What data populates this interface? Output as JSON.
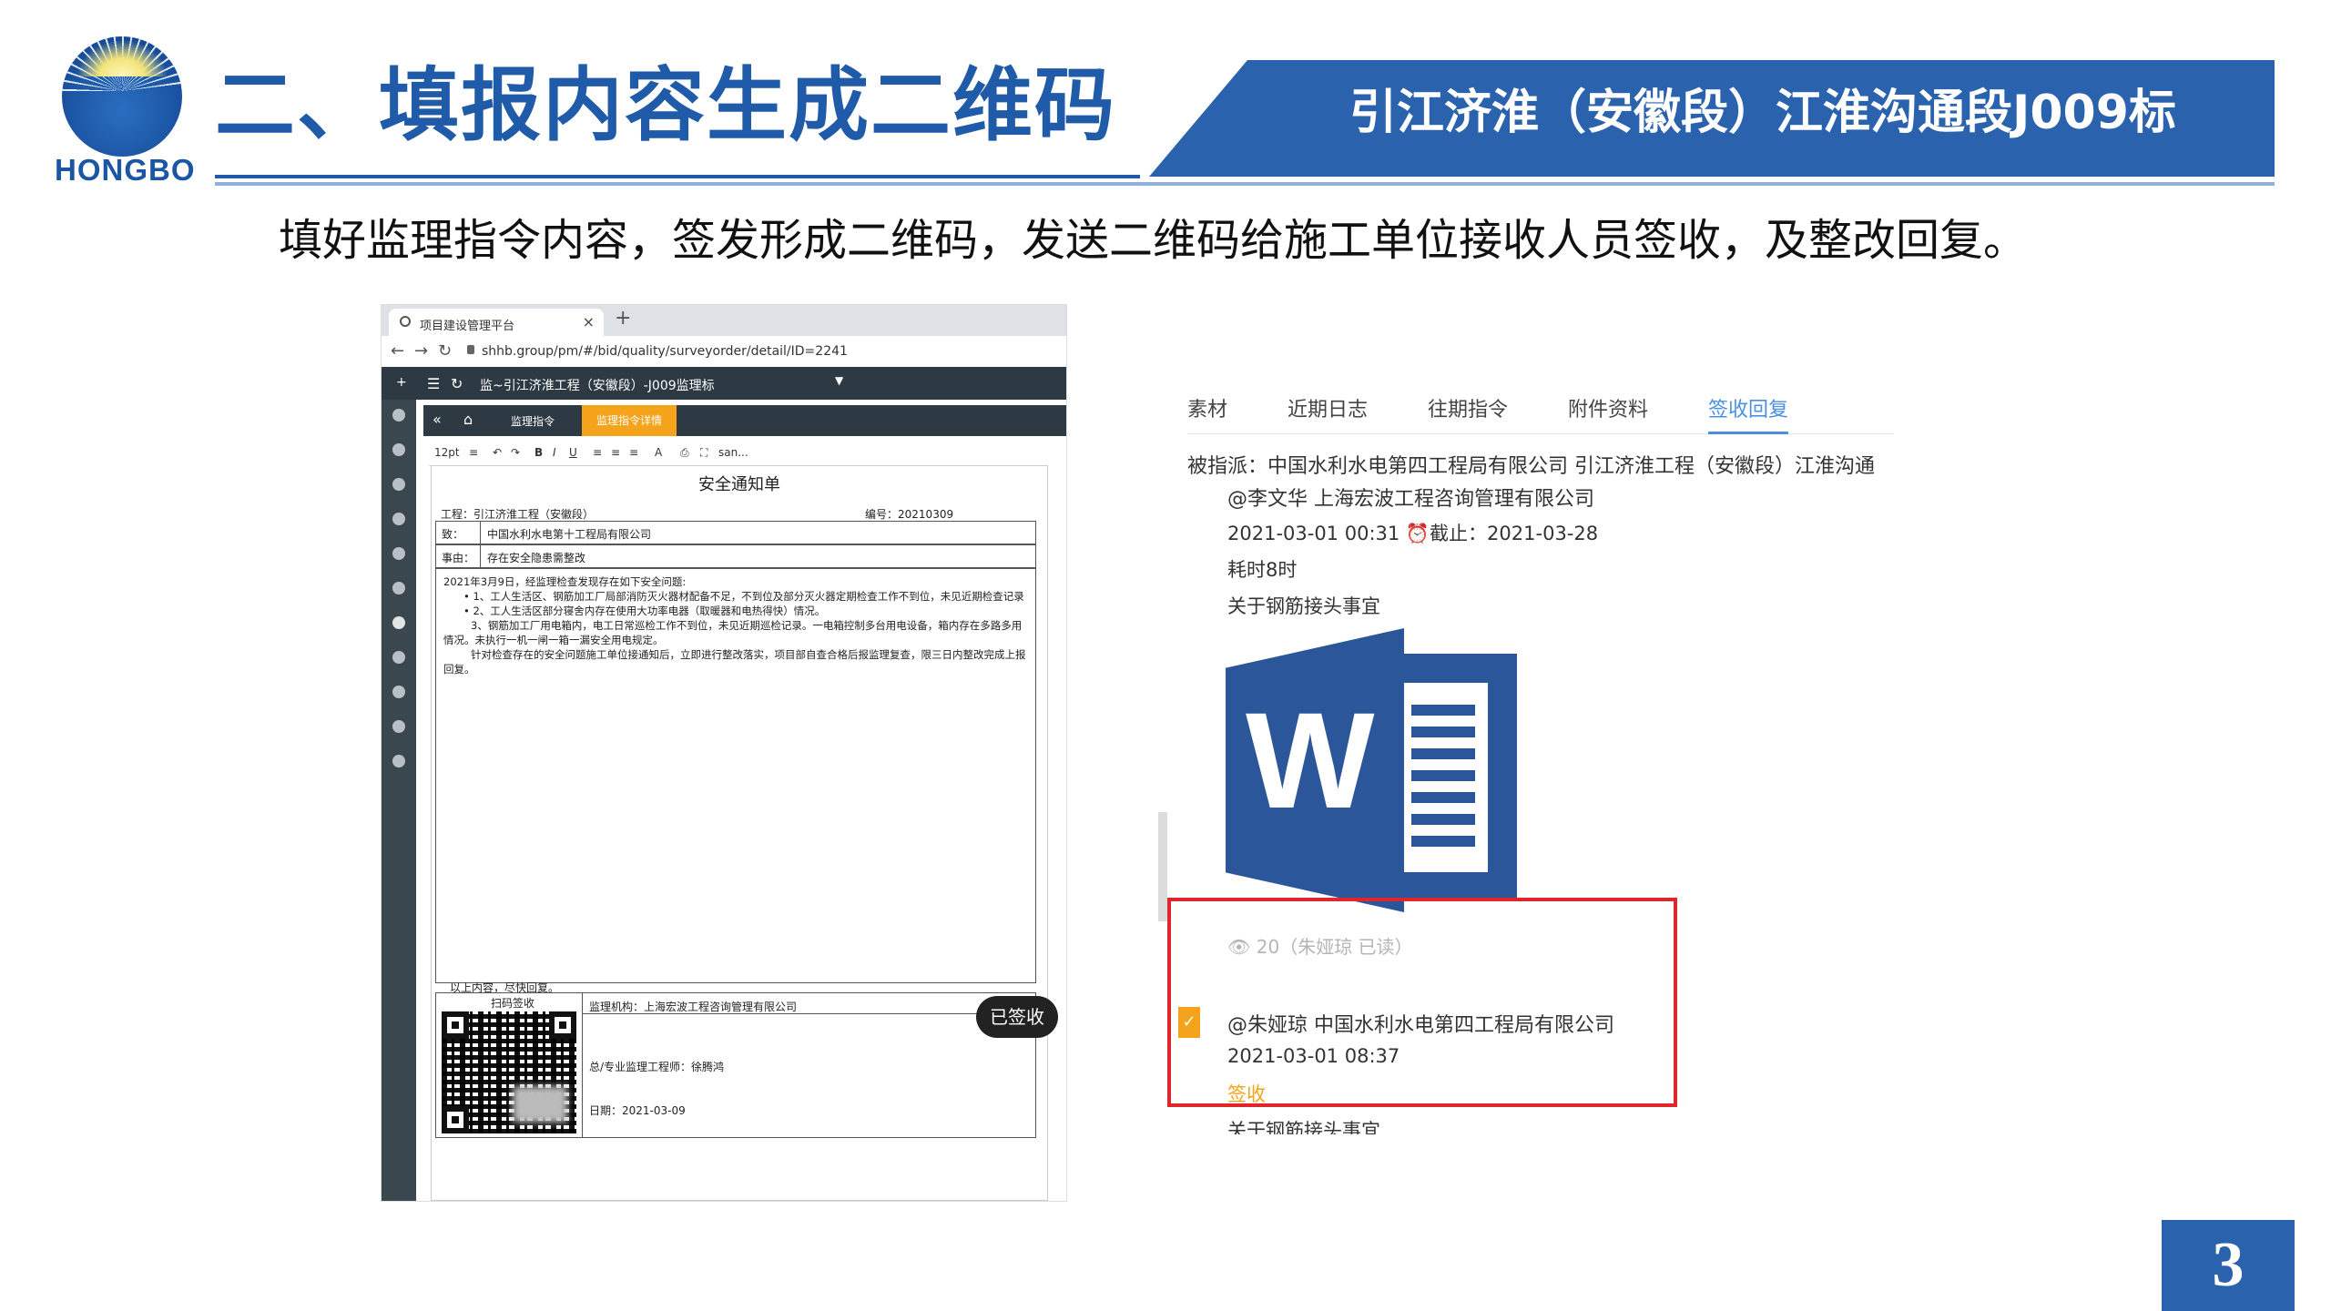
{
  "header": {
    "logo_text": "HONGBO",
    "title": "二、填报内容生成二维码",
    "project": "引江济淮（安徽段）江淮沟通段J009标"
  },
  "subtitle": "填好监理指令内容，签发形成二维码，发送二维码给施工单位接收人员签收，及整改回复。",
  "page_number": "3",
  "browser": {
    "tab_title": "项目建设管理平台",
    "url": "shhb.group/pm/#/bid/quality/surveyorder/detail/ID=2241",
    "app_title": "监~引江济淮工程（安徽段）-J009监理标",
    "tab_1": "监理指令",
    "tab_2": "监理指令详情",
    "toolbar": [
      "12pt",
      "≡",
      "↶",
      "↷",
      "B",
      "I",
      "U",
      "≡",
      "≡",
      "≡",
      "A",
      "⎙",
      "⛶",
      "san..."
    ]
  },
  "document": {
    "title": "安全通知单",
    "project_label": "工程：",
    "project_value": "引江济淮工程（安徽段）",
    "no_label": "编号：",
    "no_value": "20210309",
    "to_label": "致：",
    "to_value": "中国水利水电第十工程局有限公司",
    "matter_label": "事由：",
    "matter_value": "存在安全隐患需整改",
    "intro": "2021年3月9日，经监理检查发现存在如下安全问题:",
    "item1": "• 1、工人生活区、钢筋加工厂局部消防灭火器材配备不足，不到位及部分灭火器定期检查工作不到位，未见近期检查记录",
    "item2": "• 2、工人生活区部分寝舍内存在使用大功率电器（取暖器和电热得快）情况。",
    "item3": "3、钢筋加工厂用电箱内，电工日常巡检工作不到位，未见近期巡检记录。一电箱控制多台用电设备，箱内存在多路多用情况。未执行一机一闸一箱一漏安全用电规定。",
    "item4": "针对检查存在的安全问题施工单位接通知后，立即进行整改落实，项目部自查合格后报监理复查，限三日内整改完成上报回复。",
    "closing": "以上内容，尽快回复。",
    "qr_label": "扫码签收",
    "org": "监理机构：上海宏波工程咨询管理有限公司",
    "engineer": "总/专业监理工程师：徐腾鸿",
    "date": "日期：2021-03-09"
  },
  "stamp": "已签收",
  "mobile": {
    "tabs": [
      "素材",
      "近期日志",
      "往期指令",
      "附件资料",
      "签收回复"
    ],
    "active_tab": "签收回复",
    "assigned": "被指派：中国水利水电第四工程局有限公司 引江济淮工程（安徽段）江淮沟通",
    "mention1": "@李文华 上海宏波工程咨询管理有限公司",
    "time1": "2021-03-01 00:31 ⏰截止：2021-03-28",
    "spent": "耗时8时",
    "subject": "关于钢筋接头事宜",
    "reads": "👁 20（朱娅琼 已读）",
    "mention2": "@朱娅琼 中国水利水电第四工程局有限公司",
    "time2": "2021-03-01 08:37",
    "sign_label": "签收",
    "cut_text": "关于钢筋接头事宜"
  },
  "colors": {
    "brand": "#1f5ba8",
    "banner": "#2b62ad",
    "accent": "#f4a31b",
    "highlight": "#e0262b",
    "word": "#2b579a"
  }
}
